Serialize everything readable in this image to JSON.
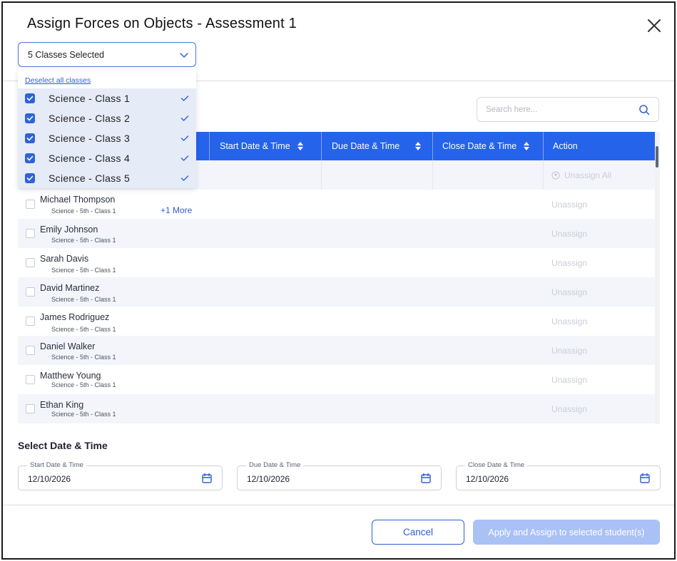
{
  "modal": {
    "title": "Assign Forces on Objects - Assessment 1",
    "close_icon": "close-icon"
  },
  "class_select": {
    "value": "5 Classes Selected",
    "deselect_label": "Deselect all classes",
    "options": [
      {
        "label": "Science - Class 1",
        "checked": true
      },
      {
        "label": "Science - Class 2",
        "checked": true
      },
      {
        "label": "Science - Class 3",
        "checked": true
      },
      {
        "label": "Science - Class 4",
        "checked": true
      },
      {
        "label": "Science - Class 5",
        "checked": true
      }
    ]
  },
  "search": {
    "placeholder": "Search here..."
  },
  "table": {
    "headers": {
      "start": "Start Date & Time",
      "due": "Due Date & Time",
      "close": "Close Date & Time",
      "action": "Action"
    },
    "unassign_all_label": "Unassign All",
    "unassign_label": "Unassign",
    "rows": [
      {
        "name": "Michael Thompson",
        "class": "Science - 5th - Class 1",
        "more": "+1 More"
      },
      {
        "name": "Emily Johnson",
        "class": "Science - 5th - Class 1"
      },
      {
        "name": "Sarah Davis",
        "class": "Science - 5th - Class 1"
      },
      {
        "name": "David Martinez",
        "class": "Science - 5th - Class 1"
      },
      {
        "name": "James Rodriguez",
        "class": "Science - 5th - Class 1"
      },
      {
        "name": "Daniel Walker",
        "class": "Science - 5th - Class 1"
      },
      {
        "name": "Matthew Young",
        "class": "Science - 5th - Class 1"
      },
      {
        "name": "Ethan King",
        "class": "Science - 5th - Class 1"
      }
    ]
  },
  "date_section": {
    "title": "Select Date & Time",
    "start": {
      "label": "Start Date & Time",
      "value": "12/10/2026"
    },
    "due": {
      "label": "Due Date & Time",
      "value": "12/10/2026"
    },
    "close": {
      "label": "Close Date & Time",
      "value": "12/10/2026"
    }
  },
  "footer": {
    "cancel_label": "Cancel",
    "apply_label": "Apply and Assign to selected student(s)"
  },
  "colors": {
    "accent": "#2563eb",
    "link": "#2f5fd0",
    "apply_disabled": "#aac1f5",
    "row_alt": "#f3f5fb"
  }
}
